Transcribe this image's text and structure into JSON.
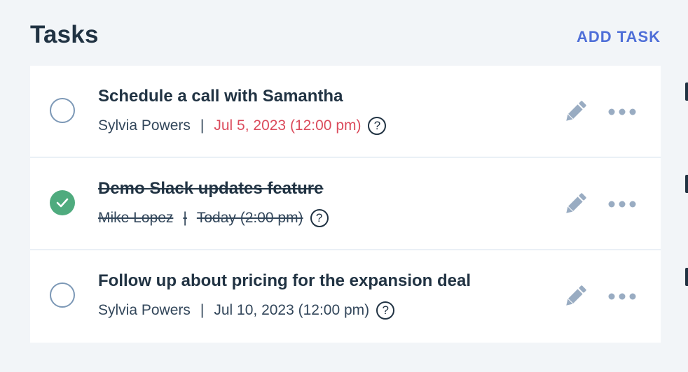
{
  "header": {
    "title": "Tasks",
    "add_label": "ADD TASK"
  },
  "tasks": [
    {
      "title": "Schedule a call with Samantha",
      "assignee": "Sylvia Powers",
      "separator": "|",
      "due": "Jul 5, 2023 (12:00 pm)",
      "help": "?",
      "completed": false,
      "overdue": true
    },
    {
      "title": "Demo Slack updates feature",
      "assignee": "Mike Lopez",
      "separator": "|",
      "due": "Today (2:00 pm)",
      "help": "?",
      "completed": true,
      "overdue": false
    },
    {
      "title": "Follow up about pricing for the expansion deal",
      "assignee": "Sylvia Powers",
      "separator": "|",
      "due": "Jul 10, 2023 (12:00 pm)",
      "help": "?",
      "completed": false,
      "overdue": false
    }
  ],
  "icons": {
    "complete": "checkbox-circle-icon",
    "completed": "checkmark-icon",
    "edit": "pencil-icon",
    "more": "ellipsis-icon",
    "help": "question-icon"
  },
  "colors": {
    "title": "#213343",
    "accent": "#4f6fd8",
    "overdue": "#db4b5c",
    "completed": "#4fab7e",
    "icon": "#99acc2",
    "background": "#f2f5f8"
  }
}
